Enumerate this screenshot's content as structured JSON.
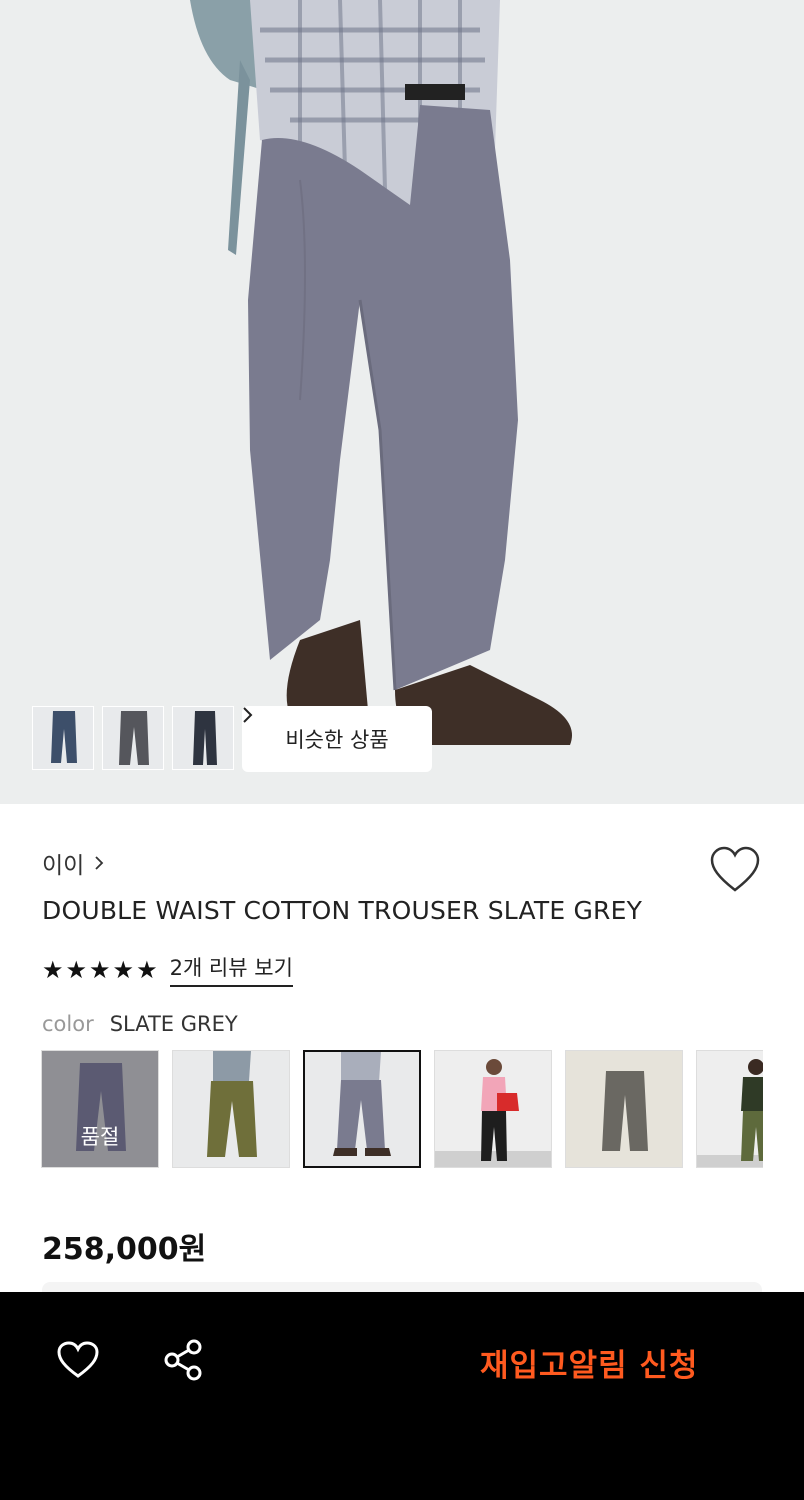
{
  "gallery": {
    "similar_button_label": "비슷한 상품",
    "thumbnails": [
      "thumb-1",
      "thumb-2",
      "thumb-3"
    ]
  },
  "product": {
    "brand": "이이",
    "title": "DOUBLE WAIST COTTON TROUSER SLATE GREY",
    "rating_stars": 5,
    "review_link": "2개 리뷰 보기",
    "color_label": "color",
    "color_value": "SLATE GREY",
    "sold_out_label": "품절",
    "price": "258,000원"
  },
  "bottom_bar": {
    "restock_label": "재입고알림 신청"
  },
  "colors": {
    "accent": "#ff5a1f",
    "bar_bg": "#000000"
  }
}
